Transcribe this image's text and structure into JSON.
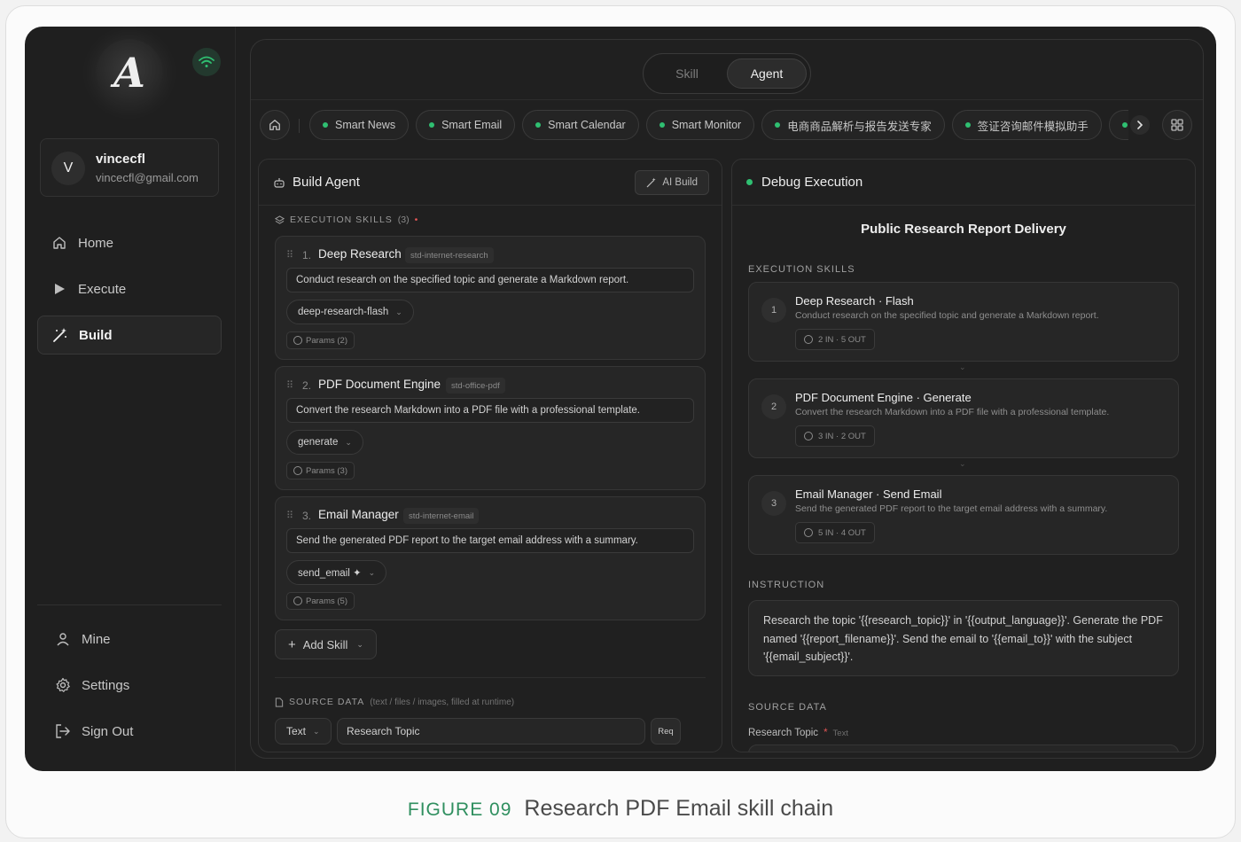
{
  "sidebar": {
    "logo_letter": "A",
    "user": {
      "initial": "V",
      "name": "vincecfl",
      "email": "vincecfl@gmail.com"
    },
    "nav": [
      {
        "label": "Home",
        "icon": "home-icon",
        "active": false
      },
      {
        "label": "Execute",
        "icon": "play-icon",
        "active": false
      },
      {
        "label": "Build",
        "icon": "magic-wand-icon",
        "active": true
      }
    ],
    "bottom": [
      {
        "label": "Mine",
        "icon": "user-icon"
      },
      {
        "label": "Settings",
        "icon": "gear-icon"
      },
      {
        "label": "Sign Out",
        "icon": "sign-out-icon"
      }
    ]
  },
  "mode": {
    "skill": "Skill",
    "agent": "Agent",
    "selected": "Agent"
  },
  "chips": [
    "Smart News",
    "Smart Email",
    "Smart Calendar",
    "Smart Monitor",
    "电商商品解析与报告发送专家",
    "签证咨询邮件模拟助手"
  ],
  "build": {
    "title": "Build Agent",
    "ai_build": "AI Build",
    "skills_label": "EXECUTION SKILLS",
    "skills_count": "(3)",
    "skills": [
      {
        "num": "1.",
        "title": "Deep Research",
        "tag": "std-internet-research",
        "desc": "Conduct research on the specified topic and generate a Markdown report.",
        "method": "deep-research-flash",
        "params": "Params (2)"
      },
      {
        "num": "2.",
        "title": "PDF Document Engine",
        "tag": "std-office-pdf",
        "desc": "Convert the research Markdown into a PDF file with a professional template.",
        "method": "generate",
        "params": "Params (3)"
      },
      {
        "num": "3.",
        "title": "Email Manager",
        "tag": "std-internet-email",
        "desc": "Send the generated PDF report to the target email address with a summary.",
        "method": "send_email ✦",
        "params": "Params (5)"
      }
    ],
    "add_skill": "Add Skill",
    "source_label": "SOURCE DATA",
    "source_hint": "(text / files / images, filled at runtime)",
    "source_type": "Text",
    "source_name": "Research Topic",
    "source_req": "Req"
  },
  "debug": {
    "title": "Debug Execution",
    "agent_name": "Public Research Report Delivery",
    "skills_label": "EXECUTION SKILLS",
    "steps": [
      {
        "num": "1",
        "title": "Deep Research · Flash",
        "desc": "Conduct research on the specified topic and generate a Markdown report.",
        "io": "2 IN · 5 OUT"
      },
      {
        "num": "2",
        "title": "PDF Document Engine · Generate",
        "desc": "Convert the research Markdown into a PDF file with a professional template.",
        "io": "3 IN · 2 OUT"
      },
      {
        "num": "3",
        "title": "Email Manager · Send Email",
        "desc": "Send the generated PDF report to the target email address with a summary.",
        "io": "5 IN · 4 OUT"
      }
    ],
    "instruction_label": "INSTRUCTION",
    "instruction": "Research the topic '{{research_topic}}' in '{{output_language}}'. Generate the PDF named '{{report_filename}}'. Send the email to '{{email_to}}' with the subject '{{email_subject}}'.",
    "source_label": "SOURCE DATA",
    "source_field": "Research Topic",
    "source_required": "*",
    "source_type": "Text"
  },
  "caption": {
    "figure": "FIGURE 09",
    "text": "Research PDF Email skill chain"
  },
  "colors": {
    "accent_green": "#2fbf71",
    "required_red": "#e05555",
    "background": "#1f1f1f"
  }
}
